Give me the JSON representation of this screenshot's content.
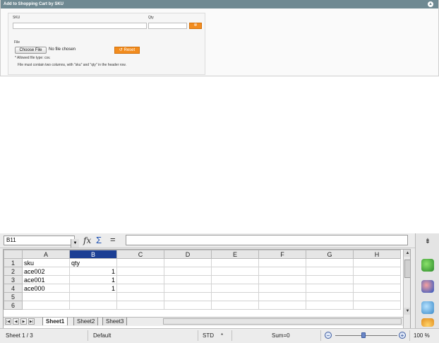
{
  "panel": {
    "title": "Add to Shopping Cart by SKU",
    "sku_label": "SKU",
    "qty_label": "Qty",
    "sku_value": "",
    "qty_value": "",
    "add_icon": "gear-icon",
    "file_label": "File",
    "choose_file_label": "Choose File",
    "no_file_text": "No file chosen",
    "reset_label": "Reset",
    "allowed_types": "* Allowed file type: csv.",
    "hint": "File must contain two columns, with \"sku\" and \"qty\" in the header row.",
    "colors": {
      "header": "#6f8992",
      "accent": "#f28c1e"
    }
  },
  "spreadsheet": {
    "name_box": "B11",
    "formula_value": "",
    "columns": [
      "A",
      "B",
      "C",
      "D",
      "E",
      "F",
      "G",
      "H"
    ],
    "selected_column": "B",
    "rows": [
      {
        "n": "1",
        "cells": [
          "sku",
          "qty",
          "",
          "",
          "",
          "",
          "",
          ""
        ]
      },
      {
        "n": "2",
        "cells": [
          "ace002",
          "1",
          "",
          "",
          "",
          "",
          "",
          ""
        ]
      },
      {
        "n": "3",
        "cells": [
          "ace001",
          "1",
          "",
          "",
          "",
          "",
          "",
          ""
        ]
      },
      {
        "n": "4",
        "cells": [
          "ace000",
          "1",
          "",
          "",
          "",
          "",
          "",
          ""
        ]
      },
      {
        "n": "5",
        "cells": [
          "",
          "",
          "",
          "",
          "",
          "",
          "",
          ""
        ]
      },
      {
        "n": "6",
        "cells": [
          "",
          "",
          "",
          "",
          "",
          "",
          "",
          ""
        ]
      }
    ],
    "tabs": [
      "Sheet1",
      "Sheet2",
      "Sheet3"
    ],
    "active_tab": "Sheet1",
    "status": {
      "sheet": "Sheet 1 / 3",
      "style": "Default",
      "mode": "STD",
      "modified": "*",
      "sum": "Sum=0",
      "zoom": "100 %",
      "zoom_level": 1.0
    },
    "colors": {
      "selection": "#1c3f94"
    }
  }
}
